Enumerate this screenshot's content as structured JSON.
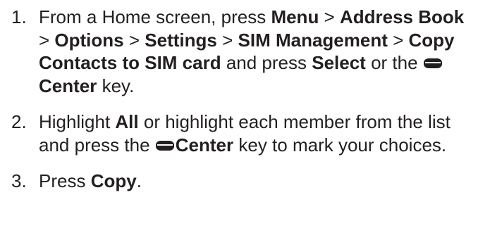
{
  "steps": [
    {
      "number": "1.",
      "parts": {
        "t1": "From a Home screen, press ",
        "b1": "Menu",
        "t2": " > ",
        "b2": "Address Book",
        "t3": " > ",
        "b3": "Options",
        "t4": " > ",
        "b4": "Settings",
        "t5": " > ",
        "b5": "SIM Management",
        "t6": " > ",
        "b6": "Copy Contacts to SIM card",
        "t7": " and press ",
        "b7": "Select",
        "t8": " or the ",
        "b8": "Center",
        "t9": " key."
      }
    },
    {
      "number": "2.",
      "parts": {
        "t1": "Highlight ",
        "b1": "All",
        "t2": " or highlight each member from the list and press the ",
        "b2": "Center",
        "t3": " key to mark your choices."
      }
    },
    {
      "number": "3.",
      "parts": {
        "t1": "Press ",
        "b1": "Copy",
        "t2": "."
      }
    }
  ],
  "icons": {
    "center_key": "center-key-icon"
  }
}
